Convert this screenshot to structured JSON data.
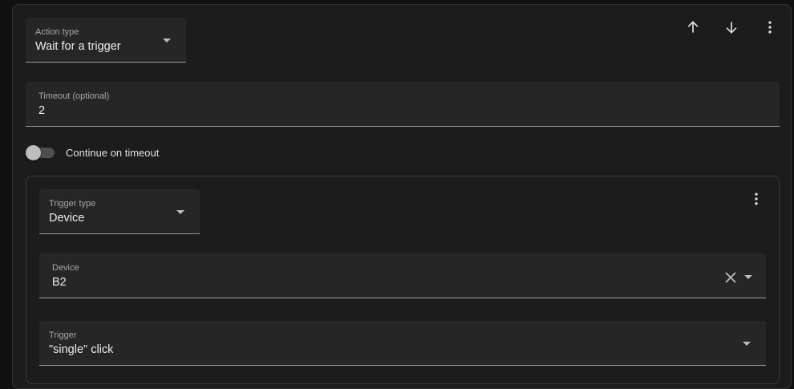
{
  "action": {
    "type_label": "Action type",
    "type_value": "Wait for a trigger",
    "toolbar": {
      "move_up_icon": "arrow-up-icon",
      "move_down_icon": "arrow-down-icon",
      "menu_icon": "dots-vertical-icon"
    },
    "timeout": {
      "label": "Timeout (optional)",
      "value": "2"
    },
    "continue_on_timeout": {
      "label": "Continue on timeout",
      "checked": false
    }
  },
  "trigger": {
    "type_label": "Trigger type",
    "type_value": "Device",
    "menu_icon": "dots-vertical-icon",
    "device": {
      "label": "Device",
      "value": "B2",
      "clear_icon": "close-icon"
    },
    "trigger_select": {
      "label": "Trigger",
      "value": "\"single\" click"
    }
  },
  "colors": {
    "background": "#111111",
    "card": "#1c1c1c",
    "field": "#262626",
    "text": "#e1e1e1",
    "secondary_text": "#a8a8a8"
  }
}
